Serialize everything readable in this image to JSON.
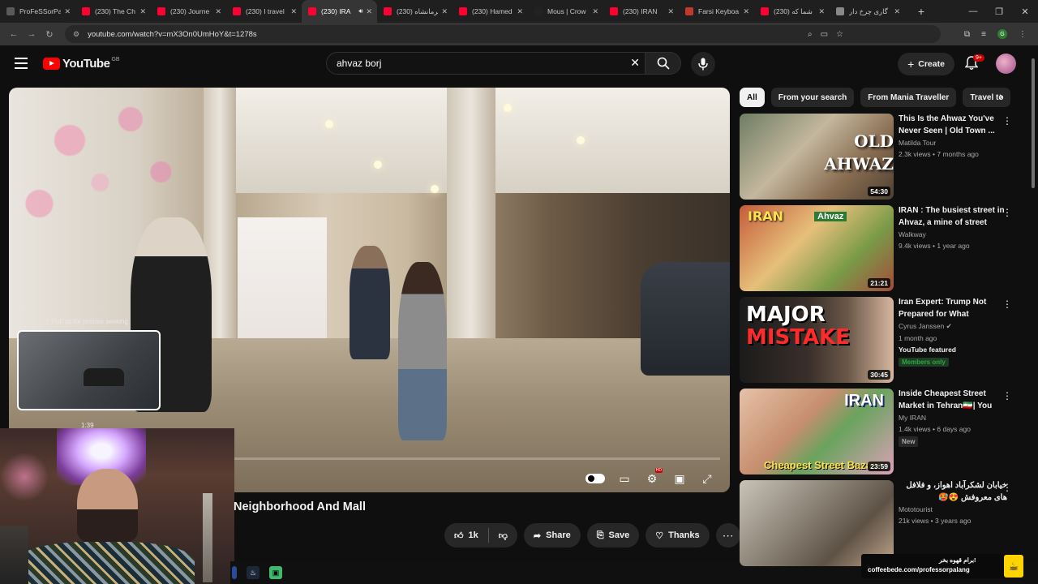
{
  "browser": {
    "tabs": [
      {
        "label": "ProFeSSorPa",
        "fav": "#5a5a5a",
        "active": false
      },
      {
        "label": "(230) The Ch",
        "fav": "#ff0033",
        "active": false
      },
      {
        "label": "(230) Journe",
        "fav": "#ff0033",
        "active": false
      },
      {
        "label": "(230) I travel",
        "fav": "#ff0033",
        "active": false
      },
      {
        "label": "(230) IRA",
        "fav": "#ff0033",
        "active": true
      },
      {
        "label": "(230) کرمانشاه",
        "fav": "#ff0033",
        "active": false
      },
      {
        "label": "(230) Hamed",
        "fav": "#ff0033",
        "active": false
      },
      {
        "label": "Mous | Crow",
        "fav": "#222222",
        "active": false
      },
      {
        "label": "(230) IRAN",
        "fav": "#ff0033",
        "active": false
      },
      {
        "label": "Farsi Keyboa",
        "fav": "#c0392b",
        "active": false
      },
      {
        "label": "(230) شما که",
        "fav": "#ff0033",
        "active": false
      },
      {
        "label": "گاری چرخ دار",
        "fav": "#888888",
        "active": false
      }
    ],
    "url": "youtube.com/watch?v=mX3On0UmHoY&t=1278s"
  },
  "youtube": {
    "logo_text": "YouTube",
    "country_code": "GB",
    "search_query": "ahvaz borj",
    "create_label": "Create",
    "notif_badge": "9+"
  },
  "player": {
    "seek_hint": "Pull up for precise seeking",
    "preview_time": "1:39",
    "progress_fraction": 0.0
  },
  "video": {
    "title": "Neighborhood And Mall",
    "like_count": "1k",
    "share_label": "Share",
    "save_label": "Save",
    "thanks_label": "Thanks"
  },
  "chips": [
    "All",
    "From your search",
    "From Mania Traveller",
    "Travel to"
  ],
  "recommendations": [
    {
      "title": "This Is the Ahwaz You've Never Seen | Old Town ...",
      "channel": "Matilda Tour",
      "stats": "2.3k views • 7 months ago",
      "duration": "54:30",
      "thumb_text": "OLD AHWAZ"
    },
    {
      "title": "IRAN : The busiest street in Ahvaz, a mine of street foo...",
      "channel": "Walkway",
      "stats": "9.4k views • 1 year ago",
      "duration": "21:21",
      "thumb_text": "IRAN",
      "thumb_text2": "Ahvaz"
    },
    {
      "title": "Iran Expert: Trump Not Prepared for What Happen...",
      "channel": "Cyrus Janssen",
      "stats": "1 month ago",
      "duration": "30:45",
      "featured": "YouTube featured",
      "members": "Members only",
      "thumb_text": "MAJOR",
      "thumb_text2": "MISTAKE"
    },
    {
      "title": "Inside Cheapest Street Market in Tehran🇮🇷| You Ca...",
      "channel": "My IRAN",
      "stats": "1.4k views • 6 days ago",
      "duration": "23:59",
      "badge": "New",
      "thumb_text": "IRAN",
      "thumb_text2": "Cheapest Street Bazaar"
    },
    {
      "title": "خیابان لشکرآباد اهواز، و فلافل های معروفش 😍🥵",
      "channel": "Mototourist",
      "stats": "21k views • 3 years ago",
      "duration": ""
    }
  ],
  "promo": {
    "line1": "برام قهوه بخر!",
    "line2": "coffeebede.com/professorpalang"
  }
}
